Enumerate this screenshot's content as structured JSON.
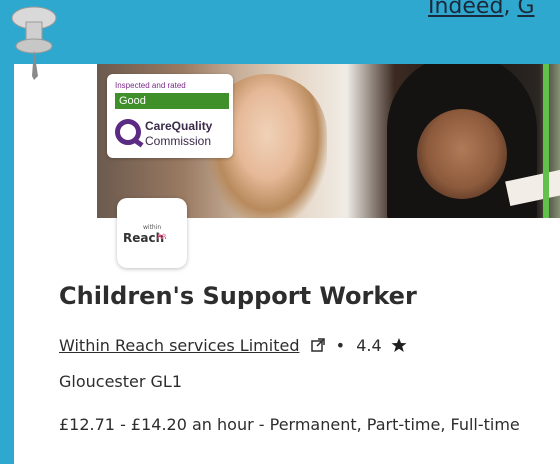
{
  "top_links": {
    "link1": "Indeed",
    "sep": ", ",
    "link2": "G"
  },
  "cqc_badge": {
    "inspected_text": "Inspected and rated",
    "rating": "Good",
    "name_line1": "CareQuality",
    "name_line2": "Commission"
  },
  "company_logo": {
    "small_text": "within",
    "word": "Reach"
  },
  "job": {
    "title": "Children's Support Worker",
    "company": "Within Reach services Limited",
    "rating_sep": "•",
    "rating": "4.4",
    "location": "Gloucester GL1",
    "salary_and_type": "£12.71 - £14.20 an hour  - Permanent, Part-time, Full-time"
  },
  "colors": {
    "page_background": "#2fa8cf",
    "card_background": "#ffffff",
    "cqc_good_green": "#3f8f2a",
    "cqc_purple": "#5b2a82"
  },
  "icons": [
    "pushpin-icon",
    "external-link-icon",
    "star-icon",
    "cqc-q-logo-icon"
  ]
}
